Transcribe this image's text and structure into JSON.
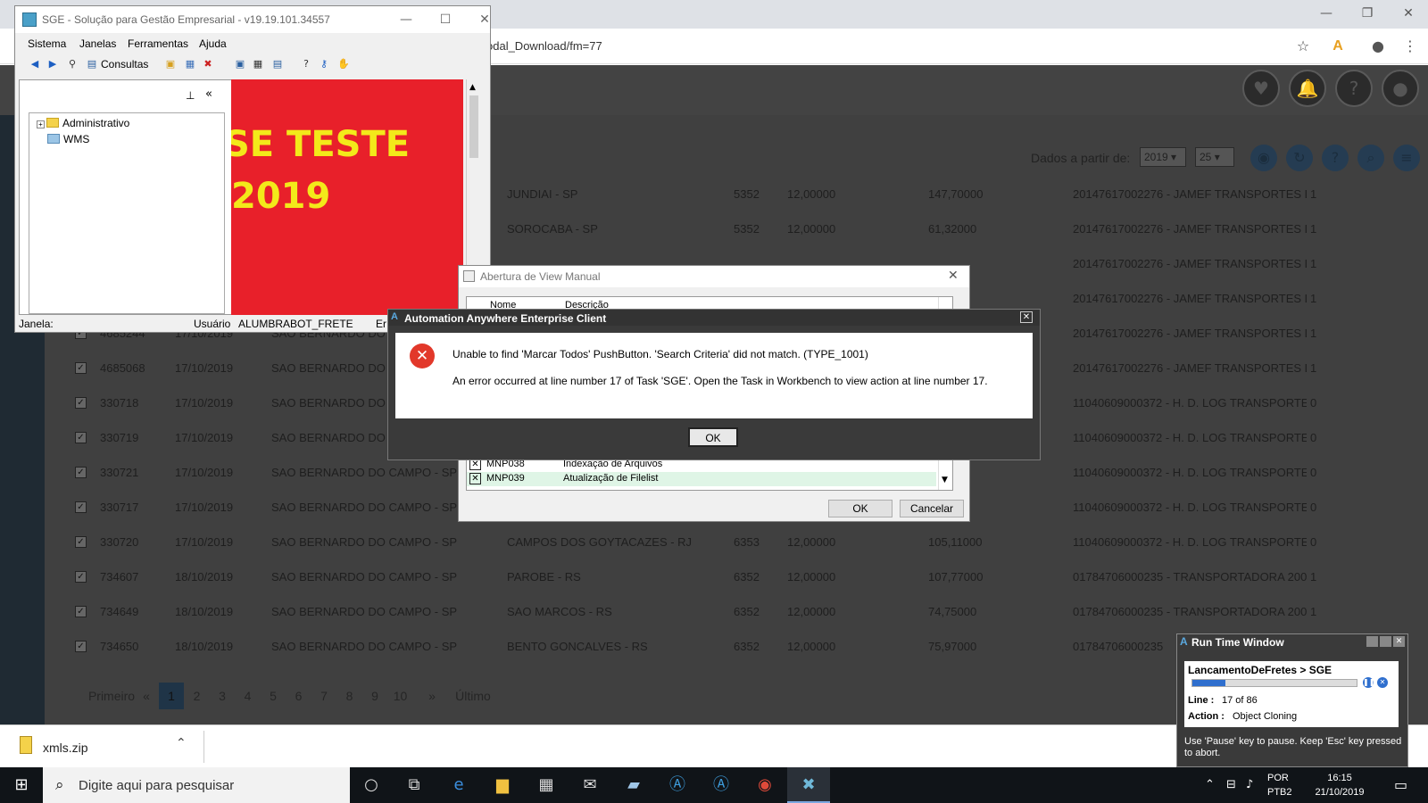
{
  "browser": {
    "address": "odal_Download/fm=77",
    "filter_label": "Dados a partir de:",
    "year_select": "2019",
    "page_size_select": "25"
  },
  "grid_rows": [
    {
      "id": "",
      "date": "",
      "origin": "",
      "dest": "JUNDIAI - SP",
      "cfop": "5352",
      "aliq": "12,00000",
      "value": "147,70000",
      "carrier": "20147617002276 - JAMEF TRANSPORTES LT...",
      "flag": "1",
      "checked": false
    },
    {
      "id": "",
      "date": "",
      "origin": "",
      "dest": "SOROCABA - SP",
      "cfop": "5352",
      "aliq": "12,00000",
      "value": "61,32000",
      "carrier": "20147617002276 - JAMEF TRANSPORTES LT...",
      "flag": "1",
      "checked": false
    },
    {
      "id": "",
      "date": "",
      "origin": "",
      "dest": "",
      "cfop": "",
      "aliq": "",
      "value": "",
      "carrier": "20147617002276 - JAMEF TRANSPORTES LT...",
      "flag": "1",
      "checked": false
    },
    {
      "id": "",
      "date": "",
      "origin": "",
      "dest": "",
      "cfop": "",
      "aliq": "",
      "value": "",
      "carrier": "20147617002276 - JAMEF TRANSPORTES LT...",
      "flag": "1",
      "checked": false
    },
    {
      "id": "4685244",
      "date": "17/10/2019",
      "origin": "SAO BERNARDO DO C",
      "dest": "",
      "cfop": "",
      "aliq": "",
      "value": "",
      "carrier": "20147617002276 - JAMEF TRANSPORTES LT...",
      "flag": "1",
      "checked": true
    },
    {
      "id": "4685068",
      "date": "17/10/2019",
      "origin": "SAO BERNARDO DO C",
      "dest": "",
      "cfop": "",
      "aliq": "",
      "value": "",
      "carrier": "20147617002276 - JAMEF TRANSPORTES LT...",
      "flag": "1",
      "checked": true
    },
    {
      "id": "330718",
      "date": "17/10/2019",
      "origin": "SAO BERNARDO DO C",
      "dest": "",
      "cfop": "",
      "aliq": "",
      "value": "",
      "carrier": "11040609000372 - H. D. LOG TRANSPORTE...",
      "flag": "0",
      "checked": true
    },
    {
      "id": "330719",
      "date": "17/10/2019",
      "origin": "SAO BERNARDO DO C",
      "dest": "",
      "cfop": "",
      "aliq": "",
      "value": "",
      "carrier": "11040609000372 - H. D. LOG TRANSPORTE...",
      "flag": "0",
      "checked": true
    },
    {
      "id": "330721",
      "date": "17/10/2019",
      "origin": "SAO BERNARDO DO CAMPO - SP",
      "dest": "",
      "cfop": "",
      "aliq": "",
      "value": "",
      "carrier": "11040609000372 - H. D. LOG TRANSPORTE...",
      "flag": "0",
      "checked": true
    },
    {
      "id": "330717",
      "date": "17/10/2019",
      "origin": "SAO BERNARDO DO CAMPO - SP",
      "dest": "",
      "cfop": "",
      "aliq": "",
      "value": "",
      "carrier": "11040609000372 - H. D. LOG TRANSPORTE...",
      "flag": "0",
      "checked": true
    },
    {
      "id": "330720",
      "date": "17/10/2019",
      "origin": "SAO BERNARDO DO CAMPO - SP",
      "dest": "CAMPOS DOS GOYTACAZES - RJ",
      "cfop": "6353",
      "aliq": "12,00000",
      "value": "105,11000",
      "carrier": "11040609000372 - H. D. LOG TRANSPORTE...",
      "flag": "0",
      "checked": true
    },
    {
      "id": "734607",
      "date": "18/10/2019",
      "origin": "SAO BERNARDO DO CAMPO - SP",
      "dest": "PAROBE - RS",
      "cfop": "6352",
      "aliq": "12,00000",
      "value": "107,77000",
      "carrier": "01784706000235 - TRANSPORTADORA 2001",
      "flag": "1",
      "checked": true
    },
    {
      "id": "734649",
      "date": "18/10/2019",
      "origin": "SAO BERNARDO DO CAMPO - SP",
      "dest": "SAO MARCOS - RS",
      "cfop": "6352",
      "aliq": "12,00000",
      "value": "74,75000",
      "carrier": "01784706000235 - TRANSPORTADORA 2001",
      "flag": "1",
      "checked": true
    },
    {
      "id": "734650",
      "date": "18/10/2019",
      "origin": "SAO BERNARDO DO CAMPO - SP",
      "dest": "BENTO GONCALVES - RS",
      "cfop": "6352",
      "aliq": "12,00000",
      "value": "75,97000",
      "carrier": "01784706000235",
      "flag": "",
      "checked": true
    }
  ],
  "pagination": {
    "first": "Primeiro",
    "prev": "«",
    "pages": [
      "1",
      "2",
      "3",
      "4",
      "5",
      "6",
      "7",
      "8",
      "9",
      "10"
    ],
    "next": "»",
    "last": "Último",
    "active": "1"
  },
  "download_bar": {
    "file_name": "xmls.zip"
  },
  "taskbar": {
    "search_placeholder": "Digite aqui para pesquisar",
    "lang1": "POR",
    "lang2": "PTB2",
    "time": "16:15",
    "date": "21/10/2019"
  },
  "sge": {
    "title": "SGE - Solução para Gestão Empresarial - v19.19.101.34557",
    "menu": [
      "Sistema",
      "Janelas",
      "Ferramentas",
      "Ajuda"
    ],
    "consultas_label": "Consultas",
    "tree": [
      "Administrativo",
      "WMS"
    ],
    "banner_line1": "SE TESTE",
    "banner_line2": "2019",
    "status_janela": "Janela:",
    "status_usuario_label": "Usuário",
    "status_usuario_value": "ALUMBRABOT_FRETE",
    "status_trailing": "Er"
  },
  "avm": {
    "title": "Abertura de View Manual",
    "col_nome": "Nome",
    "col_descricao": "Descrição",
    "rows": [
      {
        "code": "MNP038",
        "desc": "Indexação de Arquivos"
      },
      {
        "code": "MNP039",
        "desc": "Atualização de Filelist"
      }
    ],
    "ok_label": "OK",
    "cancel_label": "Cancelar"
  },
  "error_dialog": {
    "title": "Automation Anywhere Enterprise Client",
    "message1": "Unable to find 'Marcar Todos' PushButton. 'Search Criteria' did not match. (TYPE_1001)",
    "message2": "An error occurred at line number 17 of Task 'SGE'. Open the Task in Workbench to view action at line number 17.",
    "ok_label": "OK"
  },
  "runtime_window": {
    "title": "Run Time Window",
    "task": "LancamentoDeFretes > SGE",
    "progress": 0.2,
    "line_label": "Line :",
    "line_value": "17 of 86",
    "action_label": "Action :",
    "action_value": "Object Cloning",
    "footer": "Use 'Pause' key to pause. Keep 'Esc' key pressed to abort."
  }
}
